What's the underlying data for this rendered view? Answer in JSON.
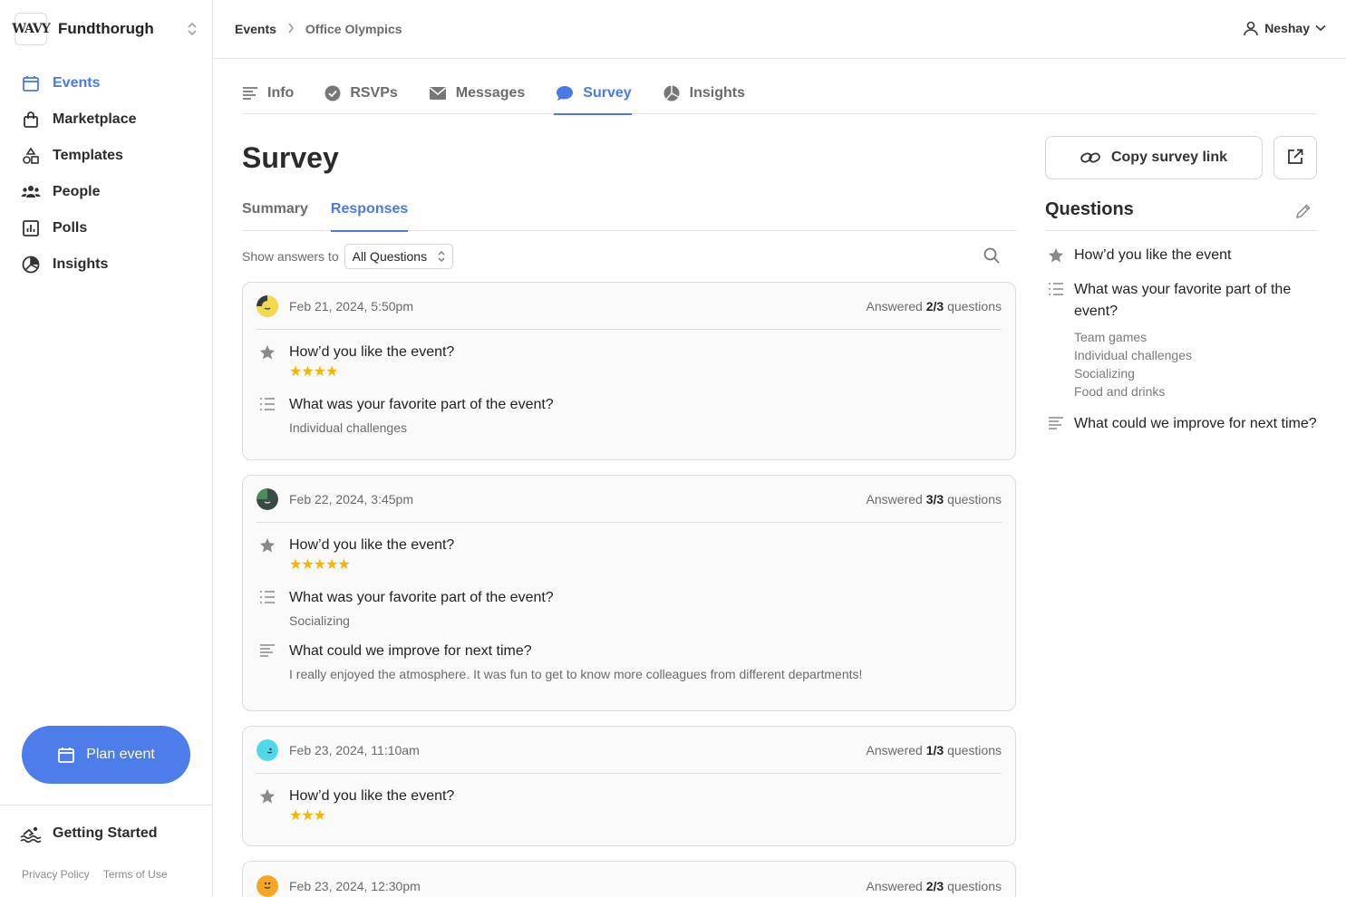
{
  "brand": {
    "logo_text": "WAVY",
    "org_name": "Fundthorugh"
  },
  "sidebar": {
    "items": [
      {
        "label": "Events",
        "icon": "calendar-icon",
        "active": true
      },
      {
        "label": "Marketplace",
        "icon": "shopping-bag-icon"
      },
      {
        "label": "Templates",
        "icon": "shapes-icon"
      },
      {
        "label": "People",
        "icon": "people-icon"
      },
      {
        "label": "Polls",
        "icon": "poll-chart-icon"
      },
      {
        "label": "Insights",
        "icon": "pie-chart-icon"
      }
    ],
    "plan_event_label": "Plan event",
    "getting_started_label": "Getting Started",
    "footer": {
      "privacy": "Privacy Policy",
      "terms": "Terms of Use"
    }
  },
  "header": {
    "breadcrumb": [
      "Events",
      "Office Olympics"
    ],
    "user_name": "Neshay"
  },
  "tabs": [
    {
      "label": "Info",
      "icon": "text-lines-icon"
    },
    {
      "label": "RSVPs",
      "icon": "check-circle-icon"
    },
    {
      "label": "Messages",
      "icon": "envelope-icon"
    },
    {
      "label": "Survey",
      "icon": "chat-bubble-icon",
      "active": true
    },
    {
      "label": "Insights",
      "icon": "pie-chart-icon"
    }
  ],
  "page": {
    "title": "Survey"
  },
  "subtabs": [
    {
      "label": "Summary"
    },
    {
      "label": "Responses",
      "active": true
    }
  ],
  "filter": {
    "label": "Show answers to",
    "selected": "All Questions"
  },
  "responses": [
    {
      "date": "Feb 21, 2024, 5:50pm",
      "answered_prefix": "Answered",
      "answered": "2/3",
      "answered_suffix": "questions",
      "avatar_color": "#f2d94e",
      "answers": [
        {
          "type": "rating",
          "question": "How’d you like the event?",
          "stars": "★★★★",
          "rating": 4
        },
        {
          "type": "choice",
          "question": "What was your favorite part of the event?",
          "answer": "Individual challenges"
        }
      ]
    },
    {
      "date": "Feb 22, 2024, 3:45pm",
      "answered_prefix": "Answered",
      "answered": "3/3",
      "answered_suffix": "questions",
      "avatar_color": "#3a4a46",
      "answers": [
        {
          "type": "rating",
          "question": "How’d you like the event?",
          "stars": "★★★★★",
          "rating": 5
        },
        {
          "type": "choice",
          "question": "What was your favorite part of the event?",
          "answer": "Socializing"
        },
        {
          "type": "text",
          "question": "What could we improve for next time?",
          "answer": "I really enjoyed the atmosphere. It was fun to get to know more colleagues from different departments!"
        }
      ]
    },
    {
      "date": "Feb 23, 2024, 11:10am",
      "answered_prefix": "Answered",
      "answered": "1/3",
      "answered_suffix": "questions",
      "avatar_color": "#4fd9e8",
      "answers": [
        {
          "type": "rating",
          "question": "How’d you like the event?",
          "stars": "★★★",
          "rating": 3
        }
      ]
    },
    {
      "date": "Feb 23, 2024, 12:30pm",
      "answered_prefix": "Answered",
      "answered": "2/3",
      "answered_suffix": "questions",
      "avatar_color": "#f5a623",
      "answers": []
    }
  ],
  "right_panel": {
    "copy_link_label": "Copy survey link",
    "questions_title": "Questions",
    "questions": [
      {
        "type": "rating",
        "text": "How’d you like the event"
      },
      {
        "type": "choice",
        "text": "What was your favorite part of the event?",
        "options": [
          "Team games",
          "Individual challenges",
          "Socializing",
          "Food and drinks"
        ]
      },
      {
        "type": "text",
        "text": "What could we improve for next time?"
      }
    ]
  },
  "colors": {
    "accent": "#4a79e8",
    "star": "#f5b400",
    "plan_button": "#4d7dea"
  }
}
